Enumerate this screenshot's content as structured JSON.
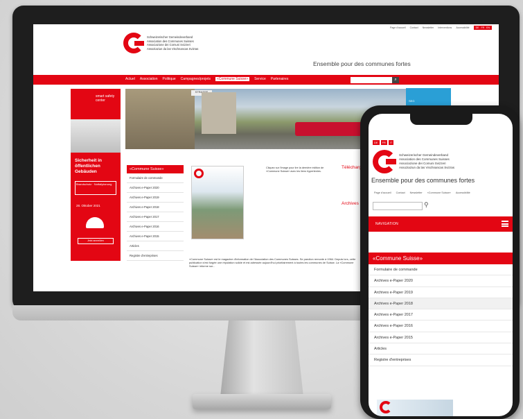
{
  "desktop": {
    "topbar": {
      "links": [
        "Page d'accueil",
        "Contact",
        "Newsletter",
        "Interventions",
        "Accessibilité"
      ],
      "langs": [
        "DE",
        "FR",
        "EN"
      ]
    },
    "logo_lines": [
      "Schweizerischer Gemeindeverband",
      "Association des Communes Suisses",
      "Associazione dei Comuni Svizzeri",
      "Assoziaziun da las Vischnancas Svizras"
    ],
    "slogan": "Ensemble pour des communes fortes",
    "nav": [
      "Actuel",
      "Association",
      "Politique",
      "Campagnes/projets",
      "«Commune Suisse»",
      "Service",
      "Partenaires"
    ],
    "nav_active": "«Commune Suisse»",
    "hero_sign": "STRASSE",
    "left_ad": {
      "brand": "smart safety center",
      "headline": "Sicherheit in öffentlichen Gebäuden",
      "box": "Brandschutz · Notfallplanung",
      "date": "28. Oktober 2021",
      "button": "Jetzt anmelden"
    },
    "sidenav": {
      "title": "«Commune Suisse»",
      "items": [
        "Formulaire de commande",
        "Archives e-Paper 2020",
        "Archives e-Paper 2019",
        "Archives e-Paper 2018",
        "Archives e-Paper 2017",
        "Archives e-Paper 2016",
        "Archives e-Paper 2015",
        "Articles",
        "Registre d'entreprises"
      ]
    },
    "info_text": "Cliquez sur l'image pour lire la dernière édition de «Commune Suisse» avec les liens hypertextes.",
    "telechargement": "Téléchargement",
    "archives": "Archives",
    "paragraph": "«Commune Suisse» est le magazine d'information de l'Association des Communes Suisses. Se parution remonte à 1964. Depuis lors, cette publication s'est forgée une réputation solide et est adressée aujourd'hui prioritairement à toutes les communes de Suisse. La «Commune Suisse» informe sur...",
    "blue_box": "SEG"
  },
  "phone": {
    "langs": [
      "DE",
      "FR",
      "IT"
    ],
    "logo_lines": [
      "Schweizerischer Gemeindeverband",
      "Association des Communes Suisses",
      "Associazione dei Comuni Svizzeri",
      "Assoziaziun da las Vischnancas Svizras"
    ],
    "slogan": "Ensemble pour des communes fortes",
    "links": [
      "Page d'accueil",
      "Contact",
      "Newsletter",
      "«Commune Suisse»",
      "Accessibilité"
    ],
    "nav_label": "NAVIGATION",
    "section_title": "«Commune Suisse»",
    "items": [
      "Formulaire de commande",
      "Archives e-Paper 2020",
      "Archives e-Paper 2019",
      "Archives e-Paper 2018",
      "Archives e-Paper 2017",
      "Archives e-Paper 2016",
      "Archives e-Paper 2015",
      "Articles",
      "Registre d'entreprises"
    ],
    "highlighted_item": "Archives e-Paper 2018"
  },
  "colors": {
    "accent": "#e30613",
    "bezel": "#1e1e1e",
    "blue": "#2a9fd6"
  }
}
